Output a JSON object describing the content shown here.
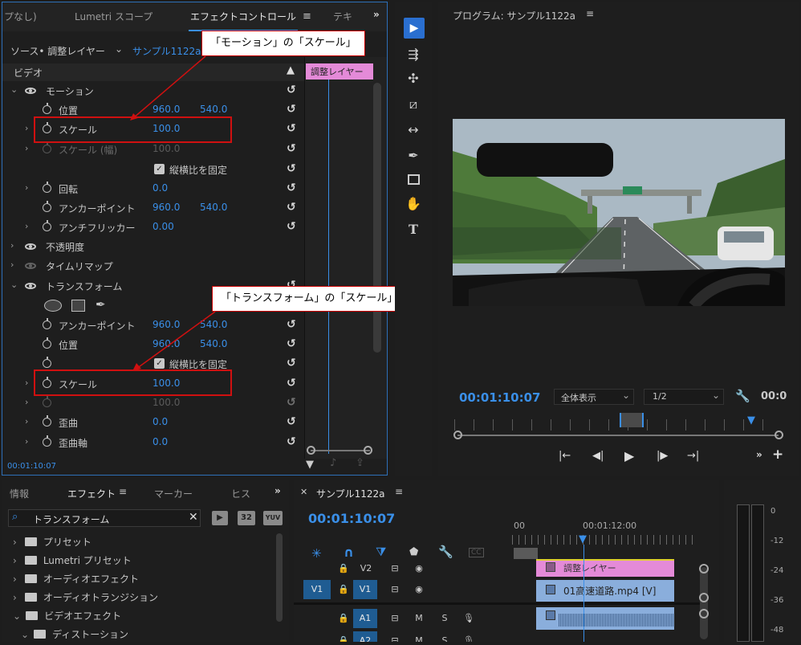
{
  "effect_controls": {
    "tabs": [
      "プなし)",
      "Lumetri スコープ",
      "エフェクトコントロール",
      "テキ"
    ],
    "source_label": "ソース• 調整レイヤー",
    "sequence_label": "サンプル1122a",
    "video_header": "ビデオ",
    "clip_label": "調整レイヤー",
    "rows": {
      "motion": "モーション",
      "position": "位置",
      "position_x": "960.0",
      "position_y": "540.0",
      "scale": "スケール",
      "scale_val": "100.0",
      "scale_w": "スケール (幅)",
      "scale_w_val": "100.0",
      "uniform": "縦横比を固定",
      "rotation": "回転",
      "rotation_val": "0.0",
      "anchor": "アンカーポイント",
      "anchor_x": "960.0",
      "anchor_y": "540.0",
      "antiflicker": "アンチフリッカー",
      "antiflicker_val": "0.00",
      "opacity": "不透明度",
      "timeremap": "タイムリマップ",
      "transform": "トランスフォーム",
      "t_anchor": "アンカーポイント",
      "t_anchor_x": "960.0",
      "t_anchor_y": "540.0",
      "t_position": "位置",
      "t_position_x": "960.0",
      "t_position_y": "540.0",
      "t_uniform": "縦横比を固定",
      "t_scale": "スケール",
      "t_scale_val": "100.0",
      "t_scale_w_val": "100.0",
      "skew": "歪曲",
      "skew_val": "0.0",
      "skew_axis": "歪曲軸",
      "skew_axis_val": "0.0"
    },
    "timecode": "00:01:10:07"
  },
  "callouts": {
    "motion_scale": "「モーション」の「スケール」",
    "transform_scale": "「トランスフォーム」の「スケール」"
  },
  "program": {
    "title": "プログラム: サンプル1122a",
    "timecode": "00:01:10:07",
    "zoom": "全体表示",
    "resolution": "1/2",
    "timecode_right": "00:0"
  },
  "effects_panel": {
    "tabs": [
      "情報",
      "エフェクト",
      "マーカー",
      "ヒス"
    ],
    "search_value": "トランスフォーム",
    "badges": [
      "32",
      "YUV"
    ],
    "items": [
      "プリセット",
      "Lumetri プリセット",
      "オーディオエフェクト",
      "オーディオトランジション",
      "ビデオエフェクト",
      "ディストーション"
    ]
  },
  "timeline": {
    "title": "サンプル1122a",
    "timecode": "00:01:10:07",
    "ruler_start": "00",
    "ruler_mid": "00:01:12:00",
    "tracks": [
      "V2",
      "V1",
      "A1",
      "A2"
    ],
    "source_v1": "V1",
    "clip_adjust": "調整レイヤー",
    "clip_video": "01高速道路.mp4 [V]",
    "track_m": "M",
    "track_s": "S"
  },
  "meter": {
    "labels": [
      "0",
      "-12",
      "-24",
      "-36",
      "-48"
    ]
  },
  "colors": {
    "accent_blue": "#3a8fe8",
    "clip_pink": "#e48ad8",
    "clip_blue": "#8aaedc",
    "callout_red": "#d01010"
  }
}
